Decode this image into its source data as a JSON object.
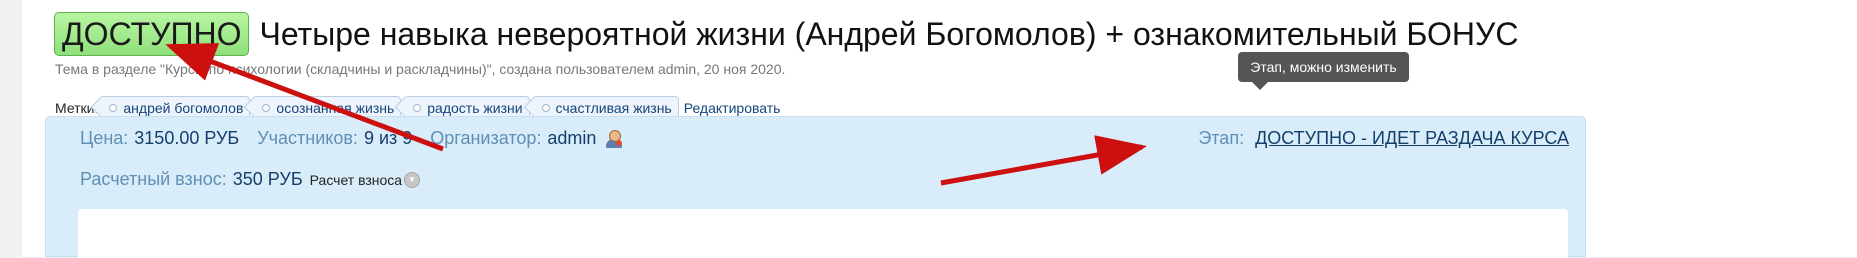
{
  "thread": {
    "badge": "ДОСТУПНО",
    "title": "Четыре навыка невероятной жизни (Андрей Богомолов) + ознакомительный БОНУС",
    "meta": "Тема в разделе \"Курсы по психологии (складчины и раскладчины)\", создана пользователем admin, 20 ноя 2020."
  },
  "tags": {
    "label": "Метки:",
    "items": [
      "андрей богомолов",
      "осознанная жизнь",
      "радость жизни",
      "счастливая жизнь"
    ],
    "edit_label": "Редактировать"
  },
  "tooltip": {
    "text": "Этап, можно изменить"
  },
  "info": {
    "price_label": "Цена:",
    "price_value": "3150.00 РУБ",
    "participants_label": "Участников:",
    "participants_value": "9 из 9",
    "organizer_label": "Организатор:",
    "organizer_value": "admin",
    "organizer_icon": "user-icon",
    "stage_label": "Этап:",
    "stage_value": "ДОСТУПНО - ИДЕТ РАЗДАЧА КУРСА",
    "fee_label": "Расчетный взнос:",
    "fee_value": "350 РУБ",
    "fee_calc_label": "Расчет взноса",
    "fee_calc_icon": "chevron-down-icon"
  },
  "colors": {
    "badge_bg": "#8fe07a",
    "panel_bg": "#d9ecf9",
    "link": "#153f6b",
    "label": "#5f8fb5",
    "annotation_arrow": "#cc1010"
  }
}
